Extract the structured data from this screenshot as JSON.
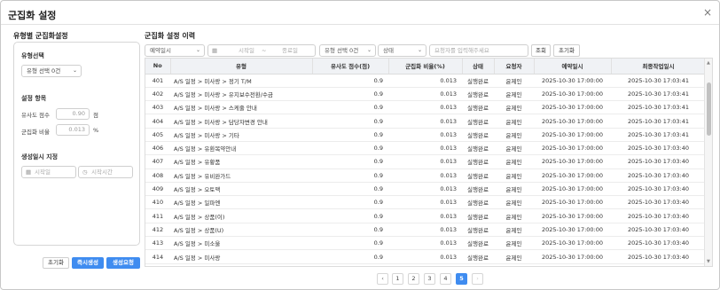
{
  "dialog": {
    "title": "군집화 설정",
    "close": "×"
  },
  "left": {
    "title": "유형별 군집화설정",
    "type_section": "유형선택",
    "type_select": "유형 선택 0건",
    "settings_section": "설정 항목",
    "similarity_label": "유사도 점수",
    "similarity_value": "0.90",
    "similarity_unit": "점",
    "cluster_label": "군집화 비율",
    "cluster_value": "0.013",
    "cluster_unit": "%",
    "gen_section": "생성일시 지정",
    "start_date_placeholder": "시작일",
    "start_time_placeholder": "시작시간",
    "btn_reset": "초기화",
    "btn_immediate": "즉시생성",
    "btn_request": "생성요청"
  },
  "right": {
    "title": "군집화 설정 이력",
    "filter_reservation": "예약일시",
    "filter_start": "시작일",
    "filter_tilde": "~",
    "filter_end": "종료일",
    "filter_type": "유형 선택 0건",
    "filter_status": "상태",
    "search_placeholder": "요청자를 입력해주세요",
    "btn_search": "조회",
    "btn_reset": "초기화"
  },
  "table": {
    "headers": [
      "No",
      "유형",
      "유사도 점수(점)",
      "군집화 비율(%)",
      "상태",
      "요청자",
      "예약일시",
      "최종작업일시"
    ],
    "rows": [
      [
        "401",
        "A/S 일정 > 미사랑 > 정기 T/M",
        "0.9",
        "0.013",
        "실행완료",
        "윤제인",
        "2025-10-30 17:00:00",
        "2025-10-30 17:03:41"
      ],
      [
        "402",
        "A/S 일정 > 미사랑 > 유지보수전환/수금",
        "0.9",
        "0.013",
        "실행완료",
        "윤제인",
        "2025-10-30 17:00:00",
        "2025-10-30 17:03:41"
      ],
      [
        "403",
        "A/S 일정 > 미사랑 > 스케줄 안내",
        "0.9",
        "0.013",
        "실행완료",
        "윤제인",
        "2025-10-30 17:00:00",
        "2025-10-30 17:03:41"
      ],
      [
        "404",
        "A/S 일정 > 미사랑 > 담당자변경 안내",
        "0.9",
        "0.013",
        "실행완료",
        "윤제인",
        "2025-10-30 17:00:00",
        "2025-10-30 17:03:41"
      ],
      [
        "405",
        "A/S 일정 > 미사랑 > 기타",
        "0.9",
        "0.013",
        "실행완료",
        "윤제인",
        "2025-10-30 17:00:00",
        "2025-10-30 17:03:41"
      ],
      [
        "406",
        "A/S 일정 > 유환복약안내",
        "0.9",
        "0.013",
        "실행완료",
        "윤제인",
        "2025-10-30 17:00:00",
        "2025-10-30 17:03:40"
      ],
      [
        "407",
        "A/S 일정 > 유황품",
        "0.9",
        "0.013",
        "실행완료",
        "윤제인",
        "2025-10-30 17:00:00",
        "2025-10-30 17:03:40"
      ],
      [
        "408",
        "A/S 일정 > 유비완가드",
        "0.9",
        "0.013",
        "실행완료",
        "윤제인",
        "2025-10-30 17:00:00",
        "2025-10-30 17:03:40"
      ],
      [
        "409",
        "A/S 일정 > 오토맥",
        "0.9",
        "0.013",
        "실행완료",
        "윤제인",
        "2025-10-30 17:00:00",
        "2025-10-30 17:03:40"
      ],
      [
        "410",
        "A/S 일정 > 일파엔",
        "0.9",
        "0.013",
        "실행완료",
        "윤제인",
        "2025-10-30 17:00:00",
        "2025-10-30 17:03:40"
      ],
      [
        "411",
        "A/S 일정 > 상품(이)",
        "0.9",
        "0.013",
        "실행완료",
        "윤제인",
        "2025-10-30 17:00:00",
        "2025-10-30 17:03:40"
      ],
      [
        "412",
        "A/S 일정 > 상품(U)",
        "0.9",
        "0.013",
        "실행완료",
        "윤제인",
        "2025-10-30 17:00:00",
        "2025-10-30 17:03:40"
      ],
      [
        "413",
        "A/S 일정 > 미소울",
        "0.9",
        "0.013",
        "실행완료",
        "윤제인",
        "2025-10-30 17:00:00",
        "2025-10-30 17:03:40"
      ],
      [
        "414",
        "A/S 일정 > 미사랑",
        "0.9",
        "0.013",
        "실행완료",
        "윤제인",
        "2025-10-30 17:00:00",
        "2025-10-30 17:03:40"
      ]
    ]
  },
  "pagination": {
    "prev": "‹",
    "next": "›",
    "pages": [
      "1",
      "2",
      "3",
      "4",
      "5"
    ],
    "active": "5"
  },
  "colors": {
    "accent": "#3f8cf0",
    "header_bg": "#f0f2f5"
  },
  "icons": {
    "calendar": "calendar-icon",
    "clock": "clock-icon",
    "chevron": "chevron-down-icon"
  }
}
